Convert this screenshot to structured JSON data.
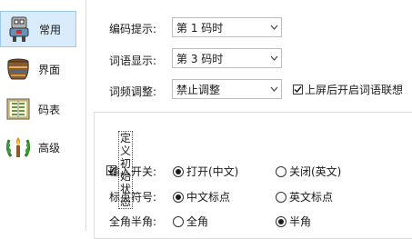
{
  "sidebar": {
    "items": [
      {
        "label": "常用",
        "icon": "robot-icon",
        "selected": true
      },
      {
        "label": "界面",
        "icon": "pot-icon",
        "selected": false
      },
      {
        "label": "码表",
        "icon": "book-icon",
        "selected": false
      },
      {
        "label": "高级",
        "icon": "laurel-torch-icon",
        "selected": false
      }
    ]
  },
  "settings": {
    "encoding_hint": {
      "label": "编码提示:",
      "value": "第 1 码时"
    },
    "word_display": {
      "label": "词语显示:",
      "value": "第 3 码时"
    },
    "freq_adjust": {
      "label": "词频调整:",
      "value": "禁止调整"
    },
    "association_checkbox": {
      "label": "上屏后开启词语联想",
      "checked": true
    }
  },
  "initial_state": {
    "title": "定义初始状态",
    "checked": true,
    "rows": [
      {
        "label": "输入开关:",
        "options": [
          {
            "label": "打开(中文)",
            "selected": true
          },
          {
            "label": "关闭(英文)",
            "selected": false
          }
        ]
      },
      {
        "label": "标点符号:",
        "options": [
          {
            "label": "中文标点",
            "selected": true
          },
          {
            "label": "英文标点",
            "selected": false
          }
        ]
      },
      {
        "label": "全角半角:",
        "options": [
          {
            "label": "全角",
            "selected": false
          },
          {
            "label": "半角",
            "selected": true
          }
        ]
      }
    ]
  },
  "colors": {
    "selected_bg": "#d9ecfb",
    "selected_border": "#99c9ef"
  }
}
